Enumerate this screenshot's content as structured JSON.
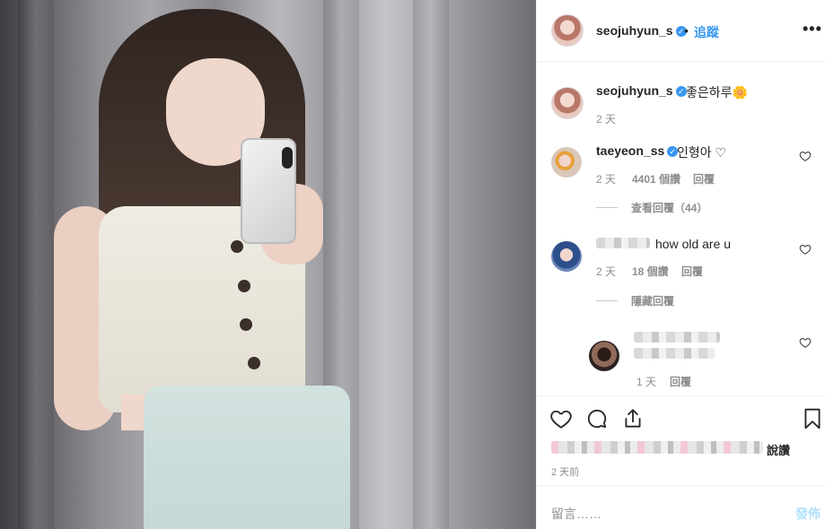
{
  "post_author": {
    "username": "seojuhyun_s",
    "verified": true
  },
  "header": {
    "separator": "•",
    "follow_label": "追蹤",
    "more_label": "•••"
  },
  "caption": {
    "username": "seojuhyun_s",
    "text": "좋은하루🌼",
    "time": "2 天"
  },
  "comments": [
    {
      "username": "taeyeon_ss",
      "verified": true,
      "text": "인형아 ♡",
      "time": "2 天",
      "likes": "4401 個讚",
      "reply_label": "回覆",
      "view_replies": "查看回覆（44）"
    },
    {
      "username": "",
      "text": "how old are u",
      "time": "2 天",
      "likes": "18 個讚",
      "reply_label": "回覆",
      "hide_replies": "隱藏回覆"
    }
  ],
  "reply": {
    "time": "1 天",
    "reply_label": "回覆"
  },
  "likes_suffix": "說讚",
  "post_time": "2 天前",
  "comment_input": {
    "placeholder": "留言……"
  },
  "post_button": "發佈",
  "icons": [
    "heart-icon",
    "comment-icon",
    "share-icon",
    "bookmark-icon",
    "verified-icon",
    "more-icon"
  ],
  "colors": {
    "accent": "#3897f0",
    "muted": "#8e8e8e",
    "text": "#262626",
    "disabled_post": "#b2dffc"
  }
}
